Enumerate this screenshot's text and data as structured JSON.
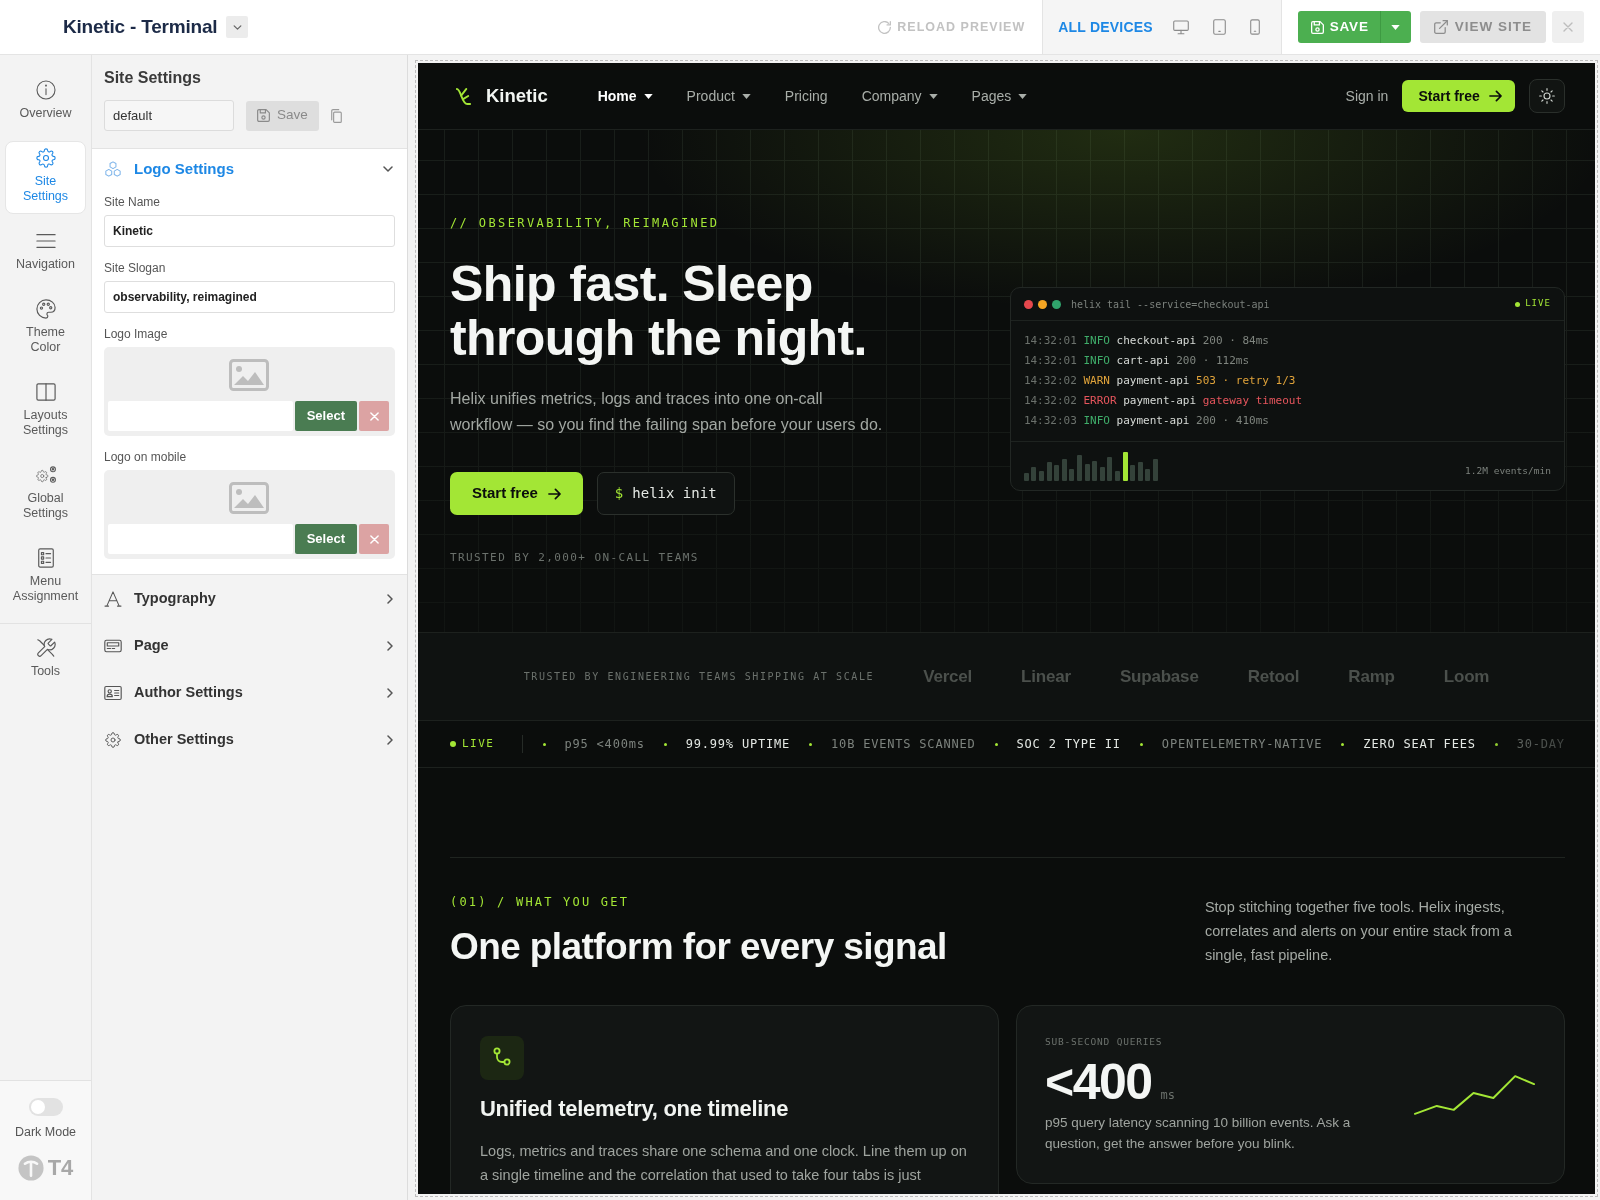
{
  "topbar": {
    "title": "Kinetic - Terminal",
    "reload": "RELOAD PREVIEW",
    "devices": [
      {
        "kind": "all",
        "label": "ALL DEVICES",
        "selected": true
      },
      {
        "kind": "desktop",
        "selected": false
      },
      {
        "kind": "tablet",
        "selected": false
      },
      {
        "kind": "phone",
        "selected": false
      }
    ],
    "save": "SAVE",
    "view_site": "VIEW SITE"
  },
  "rail": {
    "groups": [
      {
        "items": [
          {
            "label": "Overview",
            "selected": false
          },
          {
            "label": "Site Settings",
            "selected": true
          },
          {
            "label": "Navigation",
            "selected": false
          },
          {
            "label": "Theme Color",
            "selected": false
          },
          {
            "label": "Layouts Settings",
            "selected": false
          },
          {
            "label": "Global Settings",
            "selected": false
          },
          {
            "label": "Menu Assignment",
            "selected": false
          }
        ]
      },
      {
        "items": [
          {
            "label": "Tools",
            "selected": false
          }
        ]
      }
    ],
    "dark_mode": {
      "label": "Dark Mode",
      "on": false
    },
    "brand": "T4"
  },
  "panel": {
    "title": "Site Settings",
    "preset": "default",
    "save": "Save",
    "sections": [
      {
        "title": "Logo Settings",
        "expanded": true,
        "fields": [
          {
            "kind": "text",
            "label": "Site Name",
            "value": "Kinetic"
          },
          {
            "kind": "text",
            "label": "Site Slogan",
            "value": "observability, reimagined"
          },
          {
            "kind": "image",
            "label": "Logo Image",
            "button": "Select"
          },
          {
            "kind": "image",
            "label": "Logo on mobile",
            "button": "Select"
          }
        ]
      },
      {
        "title": "Typography",
        "expanded": false
      },
      {
        "title": "Page",
        "expanded": false
      },
      {
        "title": "Author Settings",
        "expanded": false
      },
      {
        "title": "Other Settings",
        "expanded": false
      }
    ]
  },
  "preview": {
    "nav": {
      "brand": "Kinetic",
      "items": [
        {
          "label": "Home",
          "dropdown": true,
          "selected": true
        },
        {
          "label": "Product",
          "dropdown": true,
          "selected": false
        },
        {
          "label": "Pricing",
          "dropdown": false,
          "selected": false
        },
        {
          "label": "Company",
          "dropdown": true,
          "selected": false
        },
        {
          "label": "Pages",
          "dropdown": true,
          "selected": false
        }
      ],
      "sign_in": "Sign in",
      "cta": "Start free"
    },
    "hero": {
      "eyebrow": "// OBSERVABILITY, REIMAGINED",
      "title": "Ship fast. Sleep through the night.",
      "text": "Helix unifies metrics, logs and traces into one on-call workflow — so you find the failing span before your users do.",
      "primary": "Start free",
      "prompt": "$",
      "command": "helix init",
      "trusted": "TRUSTED BY 2,000+ ON-CALL TEAMS"
    },
    "terminal": {
      "command": "helix tail --service=checkout-api",
      "status": "LIVE",
      "lines": [
        {
          "time": "14:32:01",
          "kind": "info",
          "level": "INFO",
          "service": "checkout-api",
          "detail": "200 · 84ms"
        },
        {
          "time": "14:32:01",
          "kind": "info",
          "level": "INFO",
          "service": "cart-api",
          "detail": "200 · 112ms"
        },
        {
          "time": "14:32:02",
          "kind": "warn",
          "level": "WARN",
          "service": "payment-api",
          "detail": "503 · retry 1/3"
        },
        {
          "time": "14:32:02",
          "kind": "error",
          "level": "ERROR",
          "service": "payment-api",
          "detail": "gateway timeout"
        },
        {
          "time": "14:32:03",
          "kind": "info",
          "level": "INFO",
          "service": "payment-api",
          "detail": "200 · 410ms"
        }
      ],
      "rate": "1.2M events/min"
    },
    "logos": {
      "label": "TRUSTED BY ENGINEERING TEAMS SHIPPING AT SCALE",
      "names": [
        "Vercel",
        "Linear",
        "Supabase",
        "Retool",
        "Ramp",
        "Loom"
      ]
    },
    "ticker": {
      "status": "LIVE",
      "items": [
        {
          "text": "p95 <400ms",
          "bright": false
        },
        {
          "text": "99.99% UPTIME",
          "bright": true
        },
        {
          "text": "10B EVENTS SCANNED",
          "bright": false
        },
        {
          "text": "SOC 2 TYPE II",
          "bright": true
        },
        {
          "text": "OPENTELEMETRY-NATIVE",
          "bright": false
        },
        {
          "text": "ZERO SEAT FEES",
          "bright": true
        },
        {
          "text": "30-DAY",
          "bright": false
        }
      ]
    },
    "features": {
      "eyebrow": "(01) / WHAT YOU GET",
      "title": "One platform for every signal",
      "intro": "Stop stitching together five tools. Helix ingests, correlates and alerts on your entire stack from a single, fast pipeline.",
      "cards": [
        {
          "kind": "feature",
          "title": "Unified telemetry, one timeline",
          "text": "Logs, metrics and traces share one schema and one clock. Line them up on a single timeline and the correlation that used to take four tabs is just"
        },
        {
          "kind": "stat",
          "label": "SUB-SECOND QUERIES",
          "value": "<400",
          "unit": "ms",
          "text": "p95 query latency scanning 10 billion events. Ask a question, get the answer before you blink."
        }
      ]
    }
  }
}
